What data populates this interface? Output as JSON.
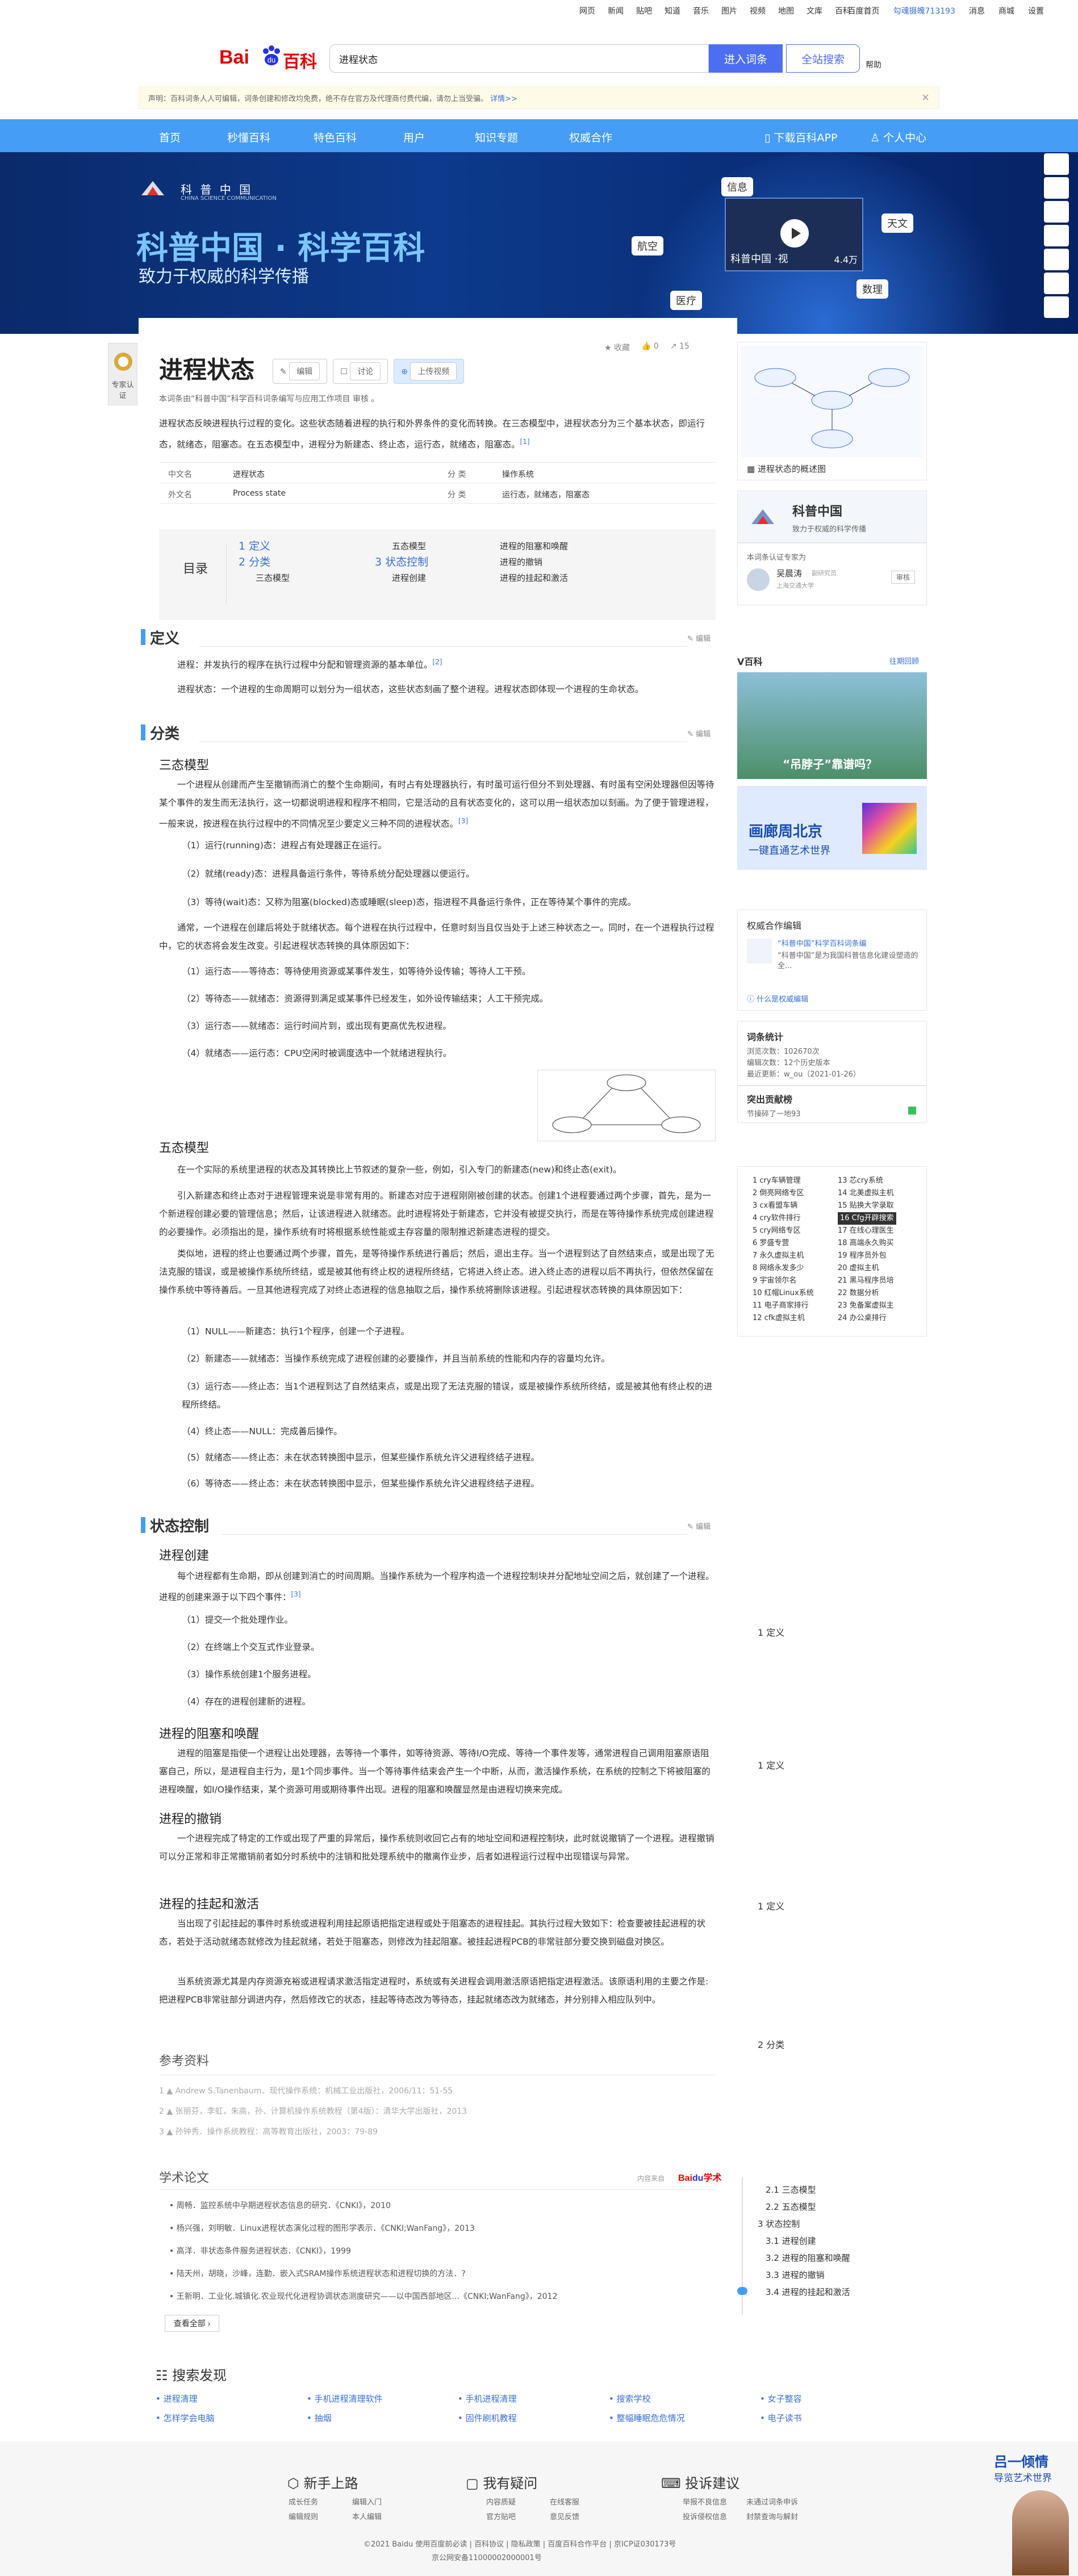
{
  "top_nav": {
    "links": [
      "网页",
      "新闻",
      "贴吧",
      "知道",
      "音乐",
      "图片",
      "视频",
      "地图",
      "文库",
      "百科"
    ],
    "user": [
      "百度首页",
      "勾魂摄魄713193",
      "消息",
      "商城",
      "设置"
    ]
  },
  "search": {
    "value": "进程状态",
    "enter_label": "进入词条",
    "all_label": "全站搜索",
    "help_label": "帮助"
  },
  "notice": {
    "text": "声明：百科词条人人可编辑，词条创建和修改均免费，绝不存在官方及代理商付费代编，请勿上当受骗。",
    "link": "详情>>"
  },
  "blue_nav": [
    "首页",
    "秒懂百科",
    "特色百科",
    "用户",
    "知识专题",
    "权威合作"
  ],
  "blue_nav_right": [
    "下载百科APP",
    "个人中心"
  ],
  "banner": {
    "cn_logo": "科 普 中 国",
    "cn_sub": "CHINA SCIENCE COMMUNICATION",
    "title": "科普中国 · 科学百科",
    "subtitle": "致力于权威的科学传播",
    "tags": [
      "信息",
      "天文",
      "航空",
      "数理",
      "医疗"
    ],
    "video_caption": "科普中国 ·视",
    "video_count": "4.4万"
  },
  "badge": "专家认证",
  "entry": {
    "title": "进程状态",
    "tools": [
      "编辑",
      "讨论",
      "上传视频"
    ],
    "stats": [
      "收藏",
      "0",
      "15"
    ],
    "review": "本词条由“科普中国”科学百科词条编写与应用工作项目 审核 。",
    "review_link": "“科普中国”科学百科词条编写与应用工作项目",
    "summary": "进程状态反映进程执行过程的变化。这些状态随着进程的执行和外界条件的变化而转换。在三态模型中，进程状态分为三个基本状态，即运行态，就绪态，阻塞态。在五态模型中，进程分为新建态、终止态，运行态，就绪态，阻塞态。",
    "summary_link": "进程",
    "sup1": "[1]"
  },
  "basic_info": [
    {
      "k1": "中文名",
      "v1": "进程状态",
      "k2": "分 类",
      "v2": "操作系统"
    },
    {
      "k1": "外文名",
      "v1": "Process state",
      "k2": "分 类",
      "v2": "运行态，就绪态，阻塞态"
    }
  ],
  "toc": {
    "label": "目录",
    "col1": [
      "1 定义",
      "2 分类",
      "三态模型"
    ],
    "col2": [
      "五态模型",
      "3 状态控制",
      "进程创建"
    ],
    "col3": [
      "进程的阻塞和唤醒",
      "进程的撤销",
      "进程的挂起和激活"
    ]
  },
  "sections": {
    "def": "定义",
    "def_p1": "进程：并发执行的程序在执行过程中分配和管理资源的基本单位。",
    "def_p1_sup": "[2]",
    "def_p2": "进程状态：一个进程的生命周期可以划分为一组状态，这些状态刻画了整个进程。进程状态即体现一个进程的生命状态。",
    "cls": "分类",
    "three": "三态模型",
    "three_p": "一个进程从创建而产生至撤销而消亡的整个生命期间，有时占有处理器执行，有时虽可运行但分不到处理器、有时虽有空闲处理器但因等待某个事件的发生而无法执行，这一切都说明进程和程序不相同，它是活动的且有状态变化的，这可以用一组状态加以刻画。为了便于管理进程，一般来说，按进程在执行过程中的不同情况至少要定义三种不同的进程状态。",
    "three_p_sup": "[3]",
    "three_items": [
      "（1）运行(running)态：进程占有处理器正在运行。",
      "（2）就绪(ready)态：进程具备运行条件，等待系统分配处理器以便运行。",
      "（3）等待(wait)态：又称为阻塞(blocked)态或睡眠(sleep)态，指进程不具备运行条件，正在等待某个事件的完成。"
    ],
    "three_p2": "通常，一个进程在创建后将处于就绪状态。每个进程在执行过程中，任意时刻当且仅当处于上述三种状态之一。同时，在一个进程执行过程中，它的状态将会发生改变。引起进程状态转换的具体原因如下：",
    "three_items2": [
      "（1）运行态——等待态：等待使用资源或某事件发生，如等待外设传输；等待人工干预。",
      "（2）等待态——就绪态：资源得到满足或某事件已经发生，如外设传输结束；人工干预完成。",
      "（3）运行态——就绪态：运行时间片到，或出现有更高优先权进程。",
      "（4）就绪态——运行态：CPU空闲时被调度选中一个就绪进程执行。"
    ],
    "five": "五态模型",
    "five_p1": "在一个实际的系统里进程的状态及其转换比上节叙述的复杂一些，例如，引入专门的新建态(new)和终止态(exit)。",
    "five_p2": "引入新建态和终止态对于进程管理来说是非常有用的。新建态对应于进程刚刚被创建的状态。创建1个进程要通过两个步骤，首先，是为一个新进程创建必要的管理信息；然后，让该进程进入就绪态。此时进程将处于新建态，它并没有被提交执行，而是在等待操作系统完成创建进程的必要操作。必须指出的是，操作系统有时将根据系统性能或主存容量的限制推迟新建态进程的提交。",
    "five_p3": "类似地，进程的终止也要通过两个步骤，首先，是等待操作系统进行善后；然后，退出主存。当一个进程到达了自然结束点，或是出现了无法克服的错误，或是被操作系统所终结，或是被其他有终止权的进程所终结，它将进入终止态。进入终止态的进程以后不再执行，但依然保留在操作系统中等待善后。一旦其他进程完成了对终止态进程的信息抽取之后，操作系统将删除该进程。引起进程状态转换的具体原因如下：",
    "five_items": [
      "（1）NULL——新建态：执行1个程序，创建一个子进程。",
      "（2）新建态——就绪态：当操作系统完成了进程创建的必要操作，并且当前系统的性能和内存的容量均允许。",
      "（3）运行态——终止态：当1个进程到达了自然结束点，或是出现了无法克服的错误，或是被操作系统所终结，或是被其他有终止权的进程所终结。",
      "（4）终止态——NULL：完成善后操作。",
      "（5）就绪态——终止态：未在状态转换图中显示，但某些操作系统允许父进程终结子进程。",
      "（6）等待态——终止态：未在状态转换图中显示，但某些操作系统允许父进程终结子进程。"
    ],
    "ctl": "状态控制",
    "create": "进程创建",
    "create_p": "每个进程都有生命期，即从创建到消亡的时间周期。当操作系统为一个程序构造一个进程控制块并分配地址空间之后，就创建了一个进程。进程的创建来源于以下四个事件：",
    "create_sup": "[3]",
    "create_items": [
      "（1）提交一个批处理作业。",
      "（2）在终端上个交互式作业登录。",
      "（3）操作系统创建1个服务进程。",
      "（4）存在的进程创建新的进程。"
    ],
    "block": "进程的阻塞和唤醒",
    "block_p": "进程的阻塞是指使一个进程让出处理器，去等待一个事件，如等待资源、等待I/O完成、等待一个事件发等，通常进程自己调用阻塞原语阻塞自己，所以，是进程自主行为，是1个同步事件。当一个等待事件结束会产生一个中断，从而，激活操作系统，在系统的控制之下将被阻塞的进程唤醒，如I/O操作结束，某个资源可用或期待事件出现。进程的阻塞和唤醒显然是由进程切换来完成。",
    "cancel": "进程的撤销",
    "cancel_p": "一个进程完成了特定的工作或出现了严重的异常后，操作系统则收回它占有的地址空间和进程控制块，此时就说撤销了一个进程。进程撤销可以分正常和非正常撤销前者如分时系统中的注销和批处理系统中的撤离作业步，后者如进程运行过程中出现错误与异常。",
    "suspend": "进程的挂起和激活",
    "suspend_p1": "当出现了引起挂起的事件时系统或进程利用挂起原语把指定进程或处于阻塞态的进程挂起。其执行过程大致如下：检查要被挂起进程的状态，若处于活动就绪态就修改为挂起就绪，若处于阻塞态，则修改为挂起阻塞。被挂起进程PCB的非常驻部分要交换到磁盘对换区。",
    "suspend_p2": "当系统资源尤其是内存资源充裕或进程请求激活指定进程时，系统或有关进程会调用激活原语把指定进程激活。该原语利用的主要之作是:把进程PCB非常驻部分调进内存，然后修改它的状态，挂起等待态改为等待态，挂起就绪态改为就绪态，并分别排入相应队列中。"
  },
  "refs": {
    "title": "参考资料",
    "items": [
      "1  ▲  Andrew S.Tanenbaum．现代操作系统：机械工业出版社，2006/11：51-55",
      "2  ▲  张丽芬，李虹，朱高，孙．计算机操作系统教程（第4版）：清华大学出版社，2013",
      "3  ▲  孙钟秀．操作系统教程：高等教育出版社，2003：79-89"
    ]
  },
  "papers": {
    "title": "学术论文",
    "source": "内容来自",
    "items": [
      "• 周畅．监控系统中孕期进程状态信息的研究．《CNKI》，2010",
      "• 杨兴强，刘明敏．Linux进程状态演化过程的图形学表示．《CNKI;WanFang》，2013",
      "• 高洋．非状态条件服务进程状态．《CNKI》，1999",
      "• 陆天州，胡晓，沙峰，连勤．嵌入式SRAM操作系统进程状态和进程切换的方法．?",
      "• 王新明．工业化.城镇化.农业现代化进程协调状态测度研究——以中国西部地区...《CNKI;WanFang》，2012"
    ],
    "more": "查看全部"
  },
  "side": {
    "img_caption": "进程状态的概述图",
    "kp_title": "科普中国",
    "kp_sub": "致力于权威的科学传播",
    "expert_label": "本词条认证专家为",
    "expert_name": "吴晨涛",
    "expert_role": "副研究员",
    "expert_org": "上海交通大学",
    "expert_btn": "审核",
    "vbk": "V百科",
    "vbk_more": "往期回顾",
    "vbk_ad1": "“吊脖子”靠谱吗？",
    "vbk_ad2": "画廊周北京",
    "vbk_ad2_sub": "一键直通艺术世界",
    "auth_title": "权威合作编辑",
    "auth_name": "“科普中国”科学百科词条编",
    "auth_desc": "“科普中国”是为我国科普信息化建设塑造的全...",
    "auth_link": "什么是权威编辑",
    "stat_title": "词条统计",
    "stat_views": "浏览次数：102670次",
    "stat_edits": "编辑次数：12个历史版本",
    "stat_update": "最近更新：w_ou（2021-01-26）",
    "sugg_title": "突出贡献榜",
    "sugg_sub": "节操碎了一地93",
    "rank_col1": [
      "1 cry车辆管理",
      "2 倒亮网络专区",
      "3 cx看盟车辆",
      "4 cry软件排行",
      "5 cry网络专区",
      "6 罗盛专营",
      "7 永久虚拟主机",
      "8 网络永发多少",
      "9 宇宙领尔名",
      "10 红帽Linux系统",
      "11 电子商家排行",
      "12 cfk虚拟主机"
    ],
    "rank_col2": [
      "13 芯cry系统",
      "14 北美虚拟主机",
      "15 贴换大学录取",
      "16 Cfg开辟搜索",
      "17 在线心理医生",
      "18 高端永久购买",
      "19 程序员外包",
      "20 虚拟主机",
      "21 黑马程序员培",
      "22 数据分析",
      "23 免备案虚拟主",
      "24 办公桌排行"
    ]
  },
  "toc_fixed": [
    "1 定义",
    "1 定义",
    "1 定义",
    "2 分类",
    "2.1 三态模型",
    "2.2 五态模型",
    "3 状态控制",
    "3.1 进程创建",
    "3.2 进程的阻塞和唤醒",
    "3.3 进程的撤销",
    "3.4 进程的挂起和激活"
  ],
  "search_found": {
    "title": "搜索发现",
    "items": [
      "• 进程清理",
      "• 手机进程清理软件",
      "• 手机进程清理",
      "• 搜索学校",
      "• 女子整容",
      "• 怎样学会电脑",
      "• 抽烟",
      "• 固件刷机教程",
      "• 整幅睡眠危危情况",
      "• 电子读书"
    ]
  },
  "footer": {
    "cols": [
      "新手上路",
      "我有疑问",
      "投诉建议"
    ],
    "links1": [
      "成长任务",
      "编辑入门",
      "编辑规则",
      "本人编辑"
    ],
    "links2": [
      "内容质疑",
      "在线客服",
      "官方贴吧",
      "意见反馈"
    ],
    "links3": [
      "举报不良信息",
      "未通过词条申诉",
      "投诉侵权信息",
      "封禁查询与解封"
    ],
    "copy": "©2021 Baidu 使用百度前必读 | 百科协议 | 隐私政策 | 百度百科合作平台 | 京ICP证030173号",
    "copy2": "京公网安备11000002000001号",
    "mascot": "吕一倾情",
    "mascot_sub": "导览艺术世界"
  }
}
